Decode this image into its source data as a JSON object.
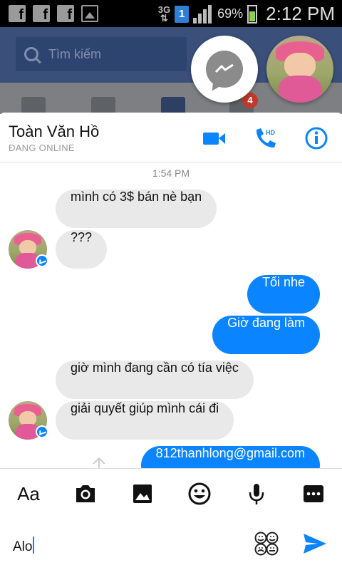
{
  "status_bar": {
    "network": "3G",
    "sim": "1",
    "battery": "69%",
    "time": "2:12 PM"
  },
  "facebook": {
    "search_placeholder": "Tìm kiếm",
    "notification_count": "4"
  },
  "chat": {
    "contact_name": "Toàn Văn Hồ",
    "contact_status": "ĐANG ONLINE",
    "timestamp": "1:54 PM",
    "messages": [
      {
        "dir": "in",
        "text": "mình có 3$ bán nè bạn"
      },
      {
        "dir": "in",
        "text": "???"
      },
      {
        "dir": "out",
        "text": "Tối nhe"
      },
      {
        "dir": "out",
        "text": "Giờ đang làm"
      },
      {
        "dir": "in",
        "text": "giờ mình đang cần có tía việc"
      },
      {
        "dir": "in",
        "text": "giải quyết giúp mình cái đi"
      },
      {
        "dir": "out",
        "text": "812thanhlong@gmail.com"
      }
    ]
  },
  "toolbar": {
    "aa_label": "Aa"
  },
  "composer": {
    "value": "Alo"
  },
  "colors": {
    "messenger_blue": "#0a84ff",
    "incoming_bubble": "#e9e9e9",
    "facebook_blue": "#3a4f7a"
  },
  "icons": [
    "camera-icon",
    "image-icon",
    "emoji-icon",
    "microphone-icon",
    "more-icon",
    "video-call-icon",
    "hd-call-icon",
    "info-icon",
    "send-icon",
    "sticker-icon",
    "share-icon"
  ]
}
